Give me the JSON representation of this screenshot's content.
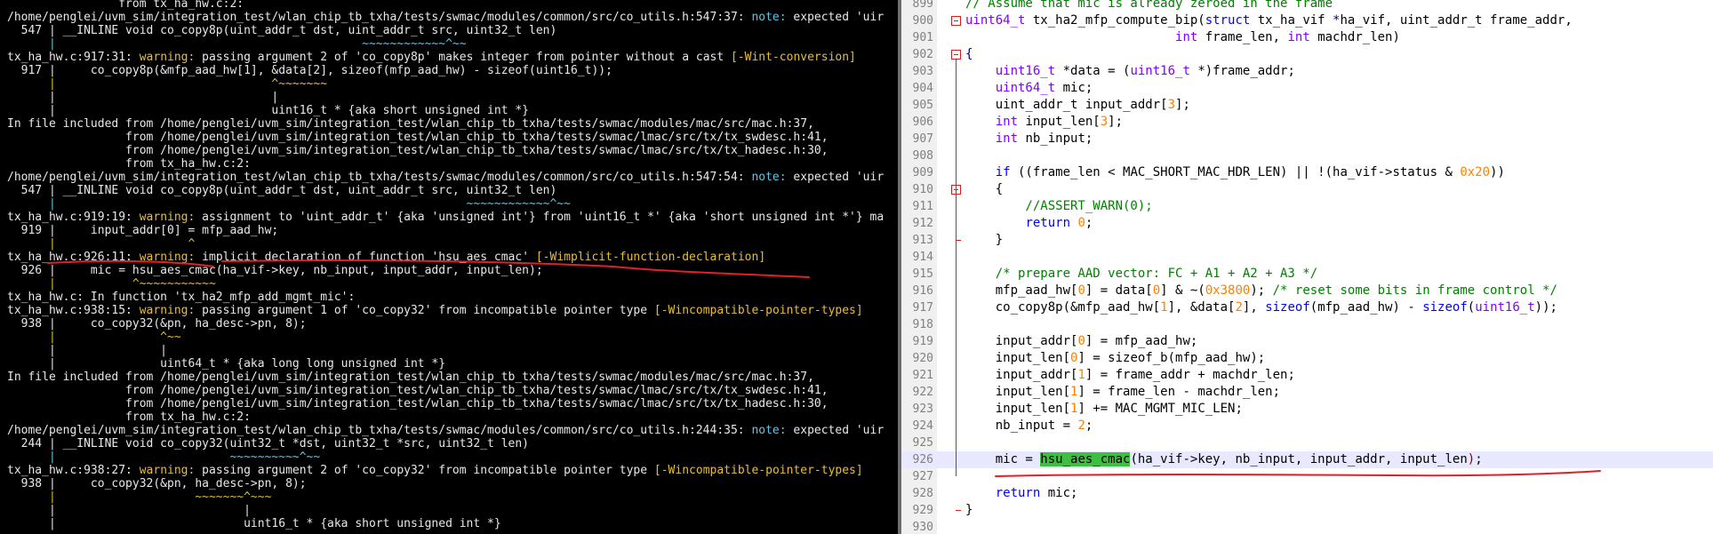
{
  "terminal": {
    "lines": [
      [
        {
          "t": "                from tx_ha_hw.c:2:",
          "c": ""
        }
      ],
      [
        {
          "t": "/home/penglei/uvm_sim/integration_test/wlan_chip_tb_txha/tests/swmac/modules/common/src/co_utils.h:547:37: ",
          "c": ""
        },
        {
          "t": "note:",
          "c": "note"
        },
        {
          "t": " expected 'uir",
          "c": ""
        }
      ],
      [
        {
          "t": "  547 | __INLINE void co_copy8p(uint_addr_t dst, uint_addr_t src, uint32_t len)",
          "c": ""
        }
      ],
      [
        {
          "t": "      |                                            ~~~~~~~~~~~~^~~",
          "c": "note"
        }
      ],
      [
        {
          "t": "tx_ha_hw.c:917:31: ",
          "c": ""
        },
        {
          "t": "warning:",
          "c": "warn"
        },
        {
          "t": " passing argument 2 of 'co_copy8p' makes integer from pointer without a cast ",
          "c": ""
        },
        {
          "t": "[-Wint-conversion]",
          "c": "flag"
        }
      ],
      [
        {
          "t": "  917 |     co_copy8p(&mfp_aad_hw[1], &data[2], sizeof(mfp_aad_hw) - sizeof(uint16_t));",
          "c": ""
        }
      ],
      [
        {
          "t": "      |                               ^~~~~~~~",
          "c": "warn"
        }
      ],
      [
        {
          "t": "      |                               |",
          "c": "ann"
        }
      ],
      [
        {
          "t": "      |                               uint16_t * {aka short unsigned int *}",
          "c": "ann"
        }
      ],
      [
        {
          "t": "In file included from /home/penglei/uvm_sim/integration_test/wlan_chip_tb_txha/tests/swmac/modules/mac/src/mac.h:37,",
          "c": ""
        }
      ],
      [
        {
          "t": "                 from /home/penglei/uvm_sim/integration_test/wlan_chip_tb_txha/tests/swmac/lmac/src/tx/tx_swdesc.h:41,",
          "c": ""
        }
      ],
      [
        {
          "t": "                 from /home/penglei/uvm_sim/integration_test/wlan_chip_tb_txha/tests/swmac/lmac/src/tx/tx_hadesc.h:30,",
          "c": ""
        }
      ],
      [
        {
          "t": "                 from tx_ha_hw.c:2:",
          "c": ""
        }
      ],
      [
        {
          "t": "/home/penglei/uvm_sim/integration_test/wlan_chip_tb_txha/tests/swmac/modules/common/src/co_utils.h:547:54: ",
          "c": ""
        },
        {
          "t": "note:",
          "c": "note"
        },
        {
          "t": " expected 'uir",
          "c": ""
        }
      ],
      [
        {
          "t": "  547 | __INLINE void co_copy8p(uint_addr_t dst, uint_addr_t src, uint32_t len)",
          "c": ""
        }
      ],
      [
        {
          "t": "      |                                                           ~~~~~~~~~~~~^~~",
          "c": "note"
        }
      ],
      [
        {
          "t": "tx_ha_hw.c:919:19: ",
          "c": ""
        },
        {
          "t": "warning:",
          "c": "warn"
        },
        {
          "t": " assignment to 'uint_addr_t' {aka 'unsigned int'} from 'uint16_t *' {aka 'short unsigned int *'} ma",
          "c": ""
        }
      ],
      [
        {
          "t": "  919 |     input_addr[0] = mfp_aad_hw;",
          "c": ""
        }
      ],
      [
        {
          "t": "      |                   ^",
          "c": "warn"
        }
      ],
      [
        {
          "t": "tx_ha_hw.c:926:11: ",
          "c": ""
        },
        {
          "t": "warning:",
          "c": "warn"
        },
        {
          "t": " implicit declaration of function 'hsu_aes_cmac' ",
          "c": ""
        },
        {
          "t": "[-Wimplicit-function-declaration]",
          "c": "flag"
        }
      ],
      [
        {
          "t": "  926 |     mic = hsu_aes_cmac(ha_vif->key, nb_input, input_addr, input_len);",
          "c": ""
        }
      ],
      [
        {
          "t": "      |           ^~~~~~~~~~~~",
          "c": "warn"
        }
      ],
      [
        {
          "t": "tx_ha_hw.c: In function 'tx_ha2_mfp_add_mgmt_mic':",
          "c": ""
        }
      ],
      [
        {
          "t": "tx_ha_hw.c:938:15: ",
          "c": ""
        },
        {
          "t": "warning:",
          "c": "warn"
        },
        {
          "t": " passing argument 1 of 'co_copy32' from incompatible pointer type ",
          "c": ""
        },
        {
          "t": "[-Wincompatible-pointer-types]",
          "c": "flag"
        }
      ],
      [
        {
          "t": "  938 |     co_copy32(&pn, ha_desc->pn, 8);",
          "c": ""
        }
      ],
      [
        {
          "t": "      |               ^~~",
          "c": "warn"
        }
      ],
      [
        {
          "t": "      |               |",
          "c": "ann"
        }
      ],
      [
        {
          "t": "      |               uint64_t * {aka long long unsigned int *}",
          "c": "ann"
        }
      ],
      [
        {
          "t": "In file included from /home/penglei/uvm_sim/integration_test/wlan_chip_tb_txha/tests/swmac/modules/mac/src/mac.h:37,",
          "c": ""
        }
      ],
      [
        {
          "t": "                 from /home/penglei/uvm_sim/integration_test/wlan_chip_tb_txha/tests/swmac/lmac/src/tx/tx_swdesc.h:41,",
          "c": ""
        }
      ],
      [
        {
          "t": "                 from /home/penglei/uvm_sim/integration_test/wlan_chip_tb_txha/tests/swmac/lmac/src/tx/tx_hadesc.h:30,",
          "c": ""
        }
      ],
      [
        {
          "t": "                 from tx_ha_hw.c:2:",
          "c": ""
        }
      ],
      [
        {
          "t": "/home/penglei/uvm_sim/integration_test/wlan_chip_tb_txha/tests/swmac/modules/common/src/co_utils.h:244:35: ",
          "c": ""
        },
        {
          "t": "note:",
          "c": "note"
        },
        {
          "t": " expected 'uir",
          "c": ""
        }
      ],
      [
        {
          "t": "  244 | __INLINE void co_copy32(uint32_t *dst, uint32_t *src, uint32_t len)",
          "c": ""
        }
      ],
      [
        {
          "t": "      |                         ~~~~~~~~~~^~~",
          "c": "note"
        }
      ],
      [
        {
          "t": "tx_ha_hw.c:938:27: ",
          "c": ""
        },
        {
          "t": "warning:",
          "c": "warn"
        },
        {
          "t": " passing argument 2 of 'co_copy32' from incompatible pointer type ",
          "c": ""
        },
        {
          "t": "[-Wincompatible-pointer-types]",
          "c": "flag"
        }
      ],
      [
        {
          "t": "  938 |     co_copy32(&pn, ha_desc->pn, 8);",
          "c": ""
        }
      ],
      [
        {
          "t": "      |                    ~~~~~~~^~~~",
          "c": "warn"
        }
      ],
      [
        {
          "t": "      |                           |",
          "c": "ann"
        }
      ],
      [
        {
          "t": "      |                           uint16_t * {aka short unsigned int *}",
          "c": "ann"
        }
      ]
    ]
  },
  "editor": {
    "lines": [
      {
        "n": "899",
        "s": [
          {
            "t": "// Assume that mic is already zeroed in the frame",
            "c": "cm"
          }
        ]
      },
      {
        "n": "900",
        "fold": "open",
        "s": [
          {
            "t": "uint64_t",
            "c": "t"
          },
          {
            "t": " tx_ha2_mfp_compute_bip(",
            "c": ""
          },
          {
            "t": "struct",
            "c": "k"
          },
          {
            "t": " tx_ha_vif ",
            "c": ""
          },
          {
            "t": "*",
            "c": "o"
          },
          {
            "t": "ha_vif, uint_addr_t frame_addr,",
            "c": ""
          }
        ]
      },
      {
        "n": "901",
        "s": [
          {
            "t": "                            ",
            "c": ""
          },
          {
            "t": "int",
            "c": "t"
          },
          {
            "t": " frame_len, ",
            "c": ""
          },
          {
            "t": "int",
            "c": "t"
          },
          {
            "t": " machdr_len)",
            "c": ""
          }
        ]
      },
      {
        "n": "902",
        "fold": "open",
        "s": [
          {
            "t": "{",
            "c": "o"
          }
        ]
      },
      {
        "n": "903",
        "s": [
          {
            "t": "    ",
            "c": ""
          },
          {
            "t": "uint16_t",
            "c": "t"
          },
          {
            "t": " *data = (",
            "c": ""
          },
          {
            "t": "uint16_t",
            "c": "t"
          },
          {
            "t": " *)frame_addr;",
            "c": ""
          }
        ]
      },
      {
        "n": "904",
        "s": [
          {
            "t": "    ",
            "c": ""
          },
          {
            "t": "uint64_t",
            "c": "t"
          },
          {
            "t": " mic;",
            "c": ""
          }
        ]
      },
      {
        "n": "905",
        "s": [
          {
            "t": "    uint_addr_t input_addr[",
            "c": ""
          },
          {
            "t": "3",
            "c": "n"
          },
          {
            "t": "];",
            "c": ""
          }
        ]
      },
      {
        "n": "906",
        "s": [
          {
            "t": "    ",
            "c": ""
          },
          {
            "t": "int",
            "c": "t"
          },
          {
            "t": " input_len[",
            "c": ""
          },
          {
            "t": "3",
            "c": "n"
          },
          {
            "t": "];",
            "c": ""
          }
        ]
      },
      {
        "n": "907",
        "s": [
          {
            "t": "    ",
            "c": ""
          },
          {
            "t": "int",
            "c": "t"
          },
          {
            "t": " nb_input;",
            "c": ""
          }
        ]
      },
      {
        "n": "908",
        "s": []
      },
      {
        "n": "909",
        "s": [
          {
            "t": "    ",
            "c": ""
          },
          {
            "t": "if",
            "c": "k"
          },
          {
            "t": " ((frame_len < MAC_SHORT_MAC_HDR_LEN) || !(ha_vif->status & ",
            "c": ""
          },
          {
            "t": "0x20",
            "c": "n"
          },
          {
            "t": "))",
            "c": ""
          }
        ]
      },
      {
        "n": "910",
        "fold": "open",
        "s": [
          {
            "t": "    {",
            "c": ""
          }
        ]
      },
      {
        "n": "911",
        "s": [
          {
            "t": "        //ASSERT_WARN(0);",
            "c": "cm"
          }
        ]
      },
      {
        "n": "912",
        "s": [
          {
            "t": "        ",
            "c": ""
          },
          {
            "t": "return",
            "c": "k"
          },
          {
            "t": " ",
            "c": ""
          },
          {
            "t": "0",
            "c": "n"
          },
          {
            "t": ";",
            "c": ""
          }
        ]
      },
      {
        "n": "913",
        "fold": "end",
        "s": [
          {
            "t": "    }",
            "c": ""
          }
        ]
      },
      {
        "n": "914",
        "s": []
      },
      {
        "n": "915",
        "s": [
          {
            "t": "    /* prepare AAD vector: FC + A1 + A2 + A3 */",
            "c": "cm"
          }
        ]
      },
      {
        "n": "916",
        "s": [
          {
            "t": "    mfp_aad_hw[",
            "c": ""
          },
          {
            "t": "0",
            "c": "n"
          },
          {
            "t": "] = data[",
            "c": ""
          },
          {
            "t": "0",
            "c": "n"
          },
          {
            "t": "] & ~(",
            "c": ""
          },
          {
            "t": "0x3800",
            "c": "n"
          },
          {
            "t": "); ",
            "c": ""
          },
          {
            "t": "/* reset some bits in frame control */",
            "c": "cm"
          }
        ]
      },
      {
        "n": "917",
        "s": [
          {
            "t": "    co_copy8p(&mfp_aad_hw[",
            "c": ""
          },
          {
            "t": "1",
            "c": "n"
          },
          {
            "t": "], &data[",
            "c": ""
          },
          {
            "t": "2",
            "c": "n"
          },
          {
            "t": "], ",
            "c": ""
          },
          {
            "t": "sizeof",
            "c": "k"
          },
          {
            "t": "(mfp_aad_hw) - ",
            "c": ""
          },
          {
            "t": "sizeof",
            "c": "k"
          },
          {
            "t": "(",
            "c": ""
          },
          {
            "t": "uint16_t",
            "c": "t"
          },
          {
            "t": "));",
            "c": ""
          }
        ]
      },
      {
        "n": "918",
        "s": []
      },
      {
        "n": "919",
        "s": [
          {
            "t": "    input_addr[",
            "c": ""
          },
          {
            "t": "0",
            "c": "n"
          },
          {
            "t": "] = mfp_aad_hw;",
            "c": ""
          }
        ]
      },
      {
        "n": "920",
        "s": [
          {
            "t": "    input_len[",
            "c": ""
          },
          {
            "t": "0",
            "c": "n"
          },
          {
            "t": "] = sizeof_b(mfp_aad_hw);",
            "c": ""
          }
        ]
      },
      {
        "n": "921",
        "s": [
          {
            "t": "    input_addr[",
            "c": ""
          },
          {
            "t": "1",
            "c": "n"
          },
          {
            "t": "] = frame_addr + machdr_len;",
            "c": ""
          }
        ]
      },
      {
        "n": "922",
        "s": [
          {
            "t": "    input_len[",
            "c": ""
          },
          {
            "t": "1",
            "c": "n"
          },
          {
            "t": "] = frame_len - machdr_len;",
            "c": ""
          }
        ]
      },
      {
        "n": "923",
        "s": [
          {
            "t": "    input_len[",
            "c": ""
          },
          {
            "t": "1",
            "c": "n"
          },
          {
            "t": "] += MAC_MGMT_MIC_LEN;",
            "c": ""
          }
        ]
      },
      {
        "n": "924",
        "s": [
          {
            "t": "    nb_input = ",
            "c": ""
          },
          {
            "t": "2",
            "c": "n"
          },
          {
            "t": ";",
            "c": ""
          }
        ]
      },
      {
        "n": "925",
        "s": []
      },
      {
        "n": "926",
        "hl": true,
        "s": [
          {
            "t": "    mic = ",
            "c": ""
          },
          {
            "t": "hsu_aes_cmac",
            "c": "sel"
          },
          {
            "t": "(ha_vif->key, nb_input, input_addr, input_len",
            "c": ""
          },
          {
            "t": ")",
            "c": "ms"
          },
          {
            "t": ";",
            "c": ""
          }
        ]
      },
      {
        "n": "927",
        "s": []
      },
      {
        "n": "928",
        "s": [
          {
            "t": "    ",
            "c": ""
          },
          {
            "t": "return",
            "c": "k"
          },
          {
            "t": " mic;",
            "c": ""
          }
        ]
      },
      {
        "n": "929",
        "fold": "end",
        "s": [
          {
            "t": "}",
            "c": ""
          }
        ]
      },
      {
        "n": "930",
        "s": []
      }
    ]
  },
  "colors": {
    "terminal_bg": "#000000",
    "warning": "#e8bd3a",
    "note": "#5fc6e8",
    "annotation_red": "#e0202a",
    "editor_highlight": "#e8e8ff",
    "selection": "#3fbf3f"
  }
}
